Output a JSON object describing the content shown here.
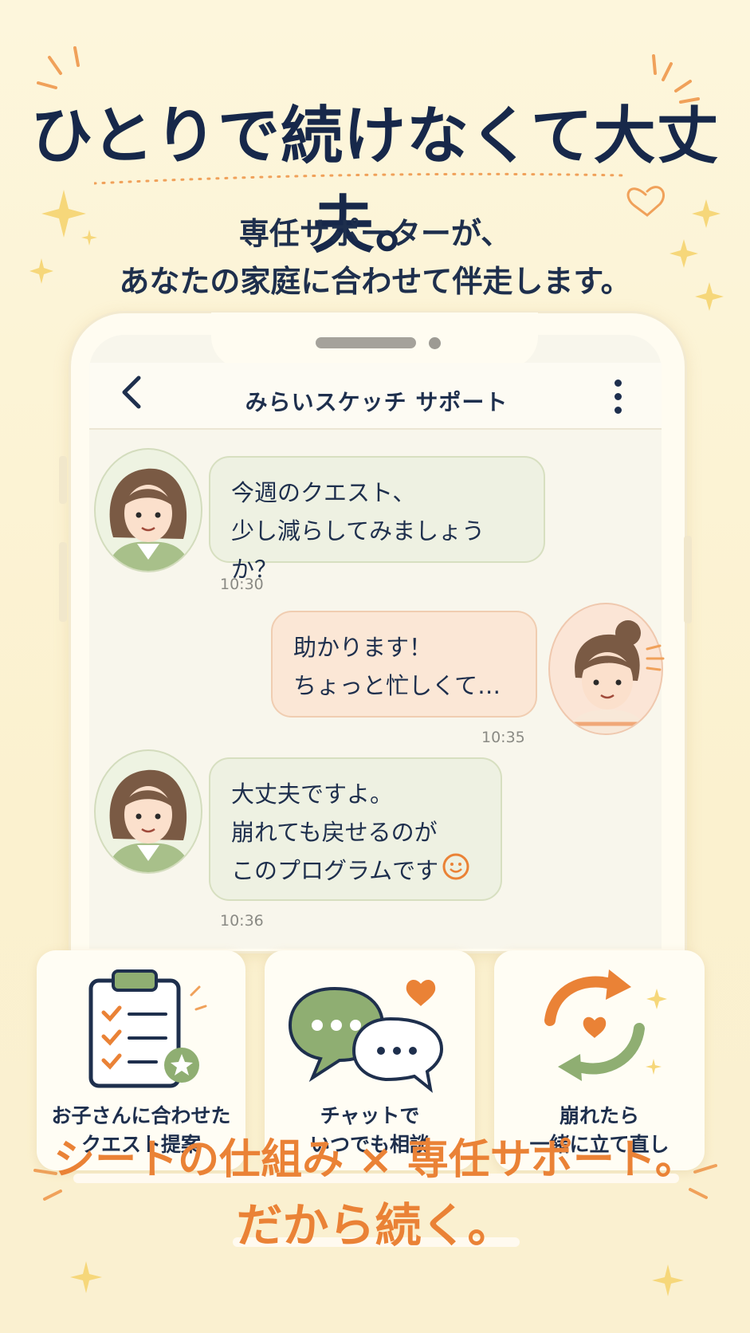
{
  "headline": "ひとりで続けなくて大丈夫。",
  "subheadline": [
    "専任サポーターが、",
    "あなたの家庭に合わせて伴走します。"
  ],
  "app": {
    "title": "みらいスケッチ サポート",
    "back_icon": "chevron-left-icon",
    "menu_icon": "more-vertical-icon"
  },
  "messages": [
    {
      "sender": "supporter",
      "lines": [
        "今週のクエスト、",
        "少し減らしてみましょうか？"
      ],
      "time": "10:30"
    },
    {
      "sender": "user",
      "lines": [
        "助かります！",
        "ちょっと忙しくて…"
      ],
      "time": "10:35"
    },
    {
      "sender": "supporter",
      "lines": [
        "大丈夫ですよ。",
        "崩れても戻せるのが",
        "このプログラムです"
      ],
      "time": "10:36",
      "emoji": "smile-icon"
    }
  ],
  "features": [
    {
      "icon": "clipboard-checklist-icon",
      "lines": [
        "お子さんに合わせた",
        "クエスト提案"
      ]
    },
    {
      "icon": "chat-bubbles-icon",
      "lines": [
        "チャットで",
        "いつでも相談"
      ]
    },
    {
      "icon": "refresh-heart-icon",
      "lines": [
        "崩れたら",
        "一緒に立て直し"
      ]
    }
  ],
  "bottom": [
    "シートの仕組み × 専任サポート。",
    "だから続く。"
  ],
  "colors": {
    "navy": "#17284a",
    "orange": "#ea8236",
    "green": "#8fae72",
    "background": "#fbf3d6"
  }
}
